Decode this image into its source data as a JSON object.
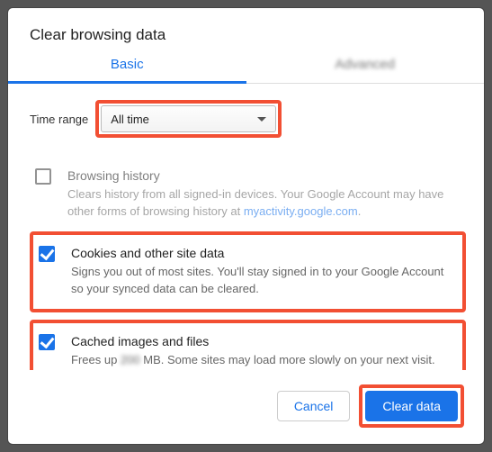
{
  "title": "Clear browsing data",
  "tabs": {
    "basic": "Basic",
    "advanced": "Advanced"
  },
  "timerange": {
    "label": "Time range",
    "value": "All time"
  },
  "options": {
    "history": {
      "name": "Browsing history",
      "desc_before": "Clears history from all signed-in devices. Your Google Account may have other forms of browsing history at ",
      "desc_link": "myactivity.google.com",
      "desc_after": "."
    },
    "cookies": {
      "name": "Cookies and other site data",
      "desc": "Signs you out of most sites. You'll stay signed in to your Google Account so your synced data can be cleared."
    },
    "cache": {
      "name": "Cached images and files",
      "desc_before": "Frees up ",
      "desc_blur": "200",
      "desc_after": " MB. Some sites may load more slowly on your next visit."
    }
  },
  "buttons": {
    "cancel": "Cancel",
    "clear": "Clear data"
  }
}
